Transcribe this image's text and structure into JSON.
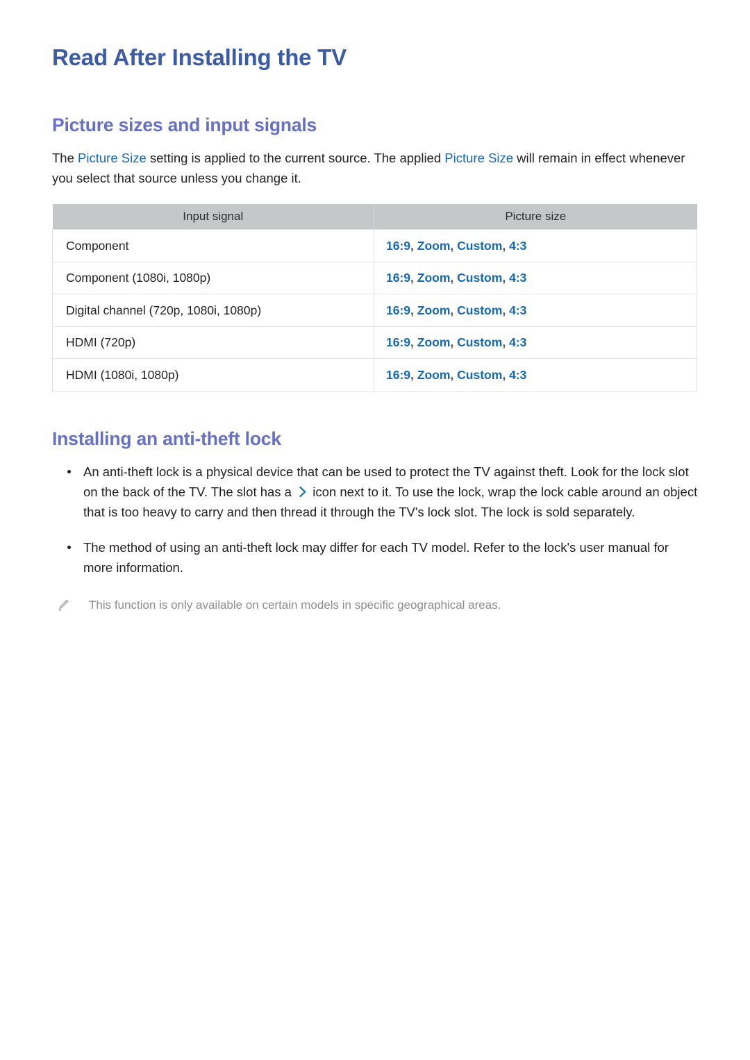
{
  "document": {
    "page_title": "Read After Installing the TV",
    "colors": {
      "page_title": "#3b5ba5",
      "section_title": "#6670c4",
      "keyword_blue": "#1668b3",
      "chevron_teal": "#19788f",
      "table_header_bg": "#c6c7c8",
      "note_gray": "#8d8d8d"
    }
  },
  "section_picture_sizes": {
    "heading": "Picture sizes and input signals",
    "intro": {
      "part1": "The ",
      "keyword1": "Picture Size",
      "part2": " setting is applied to the current source. The applied ",
      "keyword2": "Picture Size",
      "part3": " will remain in effect whenever you select that source unless you change it."
    },
    "table": {
      "headers": [
        "Input signal",
        "Picture size"
      ],
      "rows": [
        {
          "input_signal": "Component",
          "picture_size": "16:9, Zoom, Custom, 4:3"
        },
        {
          "input_signal": "Component (1080i, 1080p)",
          "picture_size": "16:9, Zoom, Custom, 4:3"
        },
        {
          "input_signal": "Digital channel (720p, 1080i, 1080p)",
          "picture_size": "16:9, Zoom, Custom, 4:3"
        },
        {
          "input_signal": "HDMI (720p)",
          "picture_size": "16:9, Zoom, Custom, 4:3"
        },
        {
          "input_signal": "HDMI (1080i, 1080p)",
          "picture_size": "16:9, Zoom, Custom, 4:3"
        }
      ]
    }
  },
  "section_anti_theft": {
    "heading": "Installing an anti-theft lock",
    "bullets": [
      {
        "text_before_icon": "An anti-theft lock is a physical device that can be used to protect the TV against theft. Look for the lock slot on the back of the TV. The slot has a ",
        "icon": "chevron-right-icon",
        "text_after_icon": " icon next to it. To use the lock, wrap the lock cable around an object that is too heavy to carry and then thread it through the TV's lock slot. The lock is sold separately."
      },
      {
        "text_before_icon": "The method of using an anti-theft lock may differ for each TV model. Refer to the lock's user manual for more information.",
        "icon": "",
        "text_after_icon": ""
      }
    ],
    "note": {
      "icon": "pencil-icon",
      "text": "This function is only available on certain models in specific geographical areas."
    }
  }
}
